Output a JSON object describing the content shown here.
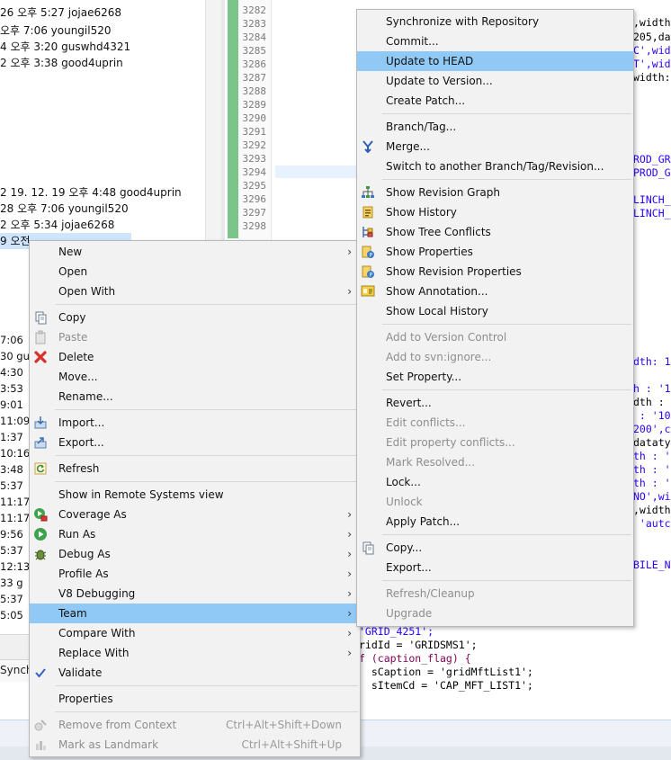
{
  "history": {
    "rows_top": [
      "26 오후 5:27  jojae6268",
      "오후 7:06  youngil520",
      "4 오후 3:20  guswhd4321",
      " 2 오후 3:38  good4uprin"
    ],
    "rows_mid": [
      "2  19. 12. 19 오후 4:48  good4uprin",
      "28 오후 7:06  youngil520",
      "2 오후 5:34  jojae6268",
      "9 오전"
    ],
    "fragments": [
      "7:06",
      "30  gu",
      "4:30",
      "3:53",
      "9:01",
      "11:09",
      "1:37",
      "10:16",
      "3:48",
      "5:37",
      "11:17",
      "11:17",
      "9:56",
      "5:37",
      "12:13",
      "33  g",
      "5:37",
      "5:05"
    ],
    "synchro_tab": "Synch"
  },
  "editor": {
    "line_numbers": [
      "3282",
      "3283",
      "3284",
      "3285",
      "3286",
      "3287",
      "3288",
      "3289",
      "3290",
      "3291",
      "3292",
      "3293",
      "3294",
      "3295",
      "3296",
      "3297",
      "3298"
    ],
    "right_fragments": [
      {
        "text": ",width",
        "color": "black"
      },
      {
        "text": "205,dat",
        "color": "black"
      },
      {
        "text": "C',wid",
        "color": "black"
      },
      {
        "text": "T',wid",
        "color": "black"
      },
      {
        "text": "width:1",
        "color": "black"
      },
      {
        "text": "ROD_GRI",
        "color": "blue"
      },
      {
        "text": "PROD_GR",
        "color": "blue"
      },
      {
        "text": "LINCH_",
        "color": "blue"
      },
      {
        "text": "LINCH_",
        "color": "blue"
      },
      {
        "text": "dth: 1",
        "color": "blue"
      },
      {
        "text": "h : '1",
        "color": "blue"
      },
      {
        "text": "dth : '",
        "color": "black"
      },
      {
        "text": " : '10",
        "color": "blue"
      },
      {
        "text": "200',c",
        "color": "blue"
      },
      {
        "text": "datatyp",
        "color": "black"
      },
      {
        "text": "th : 'a",
        "color": "blue"
      },
      {
        "text": "th : 'a",
        "color": "blue"
      },
      {
        "text": "th : 'a",
        "color": "blue"
      },
      {
        "text": "NO',wid",
        "color": "blue"
      },
      {
        "text": ",width",
        "color": "black"
      },
      {
        "text": " 'autc",
        "color": "blue"
      },
      {
        "text": "BILE_NO",
        "color": "blue"
      }
    ],
    "bottom_code": [
      "'GRID_4251';",
      "ridId = 'GRIDSMS1';",
      "f (caption_flag) {",
      "  sCaption = 'gridMftList1';",
      "  sItemCd = 'CAP_MFT_LIST1';"
    ]
  },
  "context_menu": {
    "items": [
      {
        "label": "New",
        "submenu": true
      },
      {
        "label": "Open"
      },
      {
        "label": "Open With",
        "submenu": true
      },
      {
        "label": "Copy",
        "icon": "copy-icon"
      },
      {
        "label": "Paste",
        "icon": "paste-icon",
        "disabled": true
      },
      {
        "label": "Delete",
        "icon": "delete-icon"
      },
      {
        "label": "Move..."
      },
      {
        "label": "Rename..."
      },
      {
        "label": "Import...",
        "icon": "import-icon"
      },
      {
        "label": "Export...",
        "icon": "export-icon"
      },
      {
        "label": "Refresh",
        "icon": "refresh-icon"
      },
      {
        "label": "Show in Remote Systems view"
      },
      {
        "label": "Coverage As",
        "icon": "coverage-icon",
        "submenu": true
      },
      {
        "label": "Run As",
        "icon": "run-icon",
        "submenu": true
      },
      {
        "label": "Debug As",
        "icon": "debug-icon",
        "submenu": true
      },
      {
        "label": "Profile As",
        "submenu": true
      },
      {
        "label": "V8 Debugging",
        "submenu": true
      },
      {
        "label": "Team",
        "submenu": true,
        "highlighted": true
      },
      {
        "label": "Compare With",
        "submenu": true
      },
      {
        "label": "Replace With",
        "submenu": true
      },
      {
        "label": "Validate",
        "icon": "check-icon"
      },
      {
        "label": "Properties"
      },
      {
        "label": "Remove from Context",
        "shortcut": "Ctrl+Alt+Shift+Down",
        "disabled": true
      },
      {
        "label": "Mark as Landmark",
        "shortcut": "Ctrl+Alt+Shift+Up",
        "disabled": true
      }
    ]
  },
  "team_menu": {
    "items": [
      {
        "label": "Synchronize with Repository"
      },
      {
        "label": "Commit..."
      },
      {
        "label": "Update to HEAD",
        "highlighted": true
      },
      {
        "label": "Update to Version..."
      },
      {
        "label": "Create Patch..."
      },
      {
        "label": "Branch/Tag..."
      },
      {
        "label": "Merge...",
        "icon": "merge-icon"
      },
      {
        "label": "Switch to another Branch/Tag/Revision..."
      },
      {
        "label": "Show Revision Graph",
        "icon": "revision-graph-icon"
      },
      {
        "label": "Show History",
        "icon": "history-icon"
      },
      {
        "label": "Show Tree Conflicts",
        "icon": "tree-conflicts-icon"
      },
      {
        "label": "Show Properties",
        "icon": "properties-icon"
      },
      {
        "label": "Show Revision Properties",
        "icon": "revision-properties-icon"
      },
      {
        "label": "Show Annotation...",
        "icon": "annotation-icon"
      },
      {
        "label": "Show Local History"
      },
      {
        "label": "Add to Version Control",
        "disabled": true
      },
      {
        "label": "Add to svn:ignore...",
        "disabled": true
      },
      {
        "label": "Set Property..."
      },
      {
        "label": "Revert..."
      },
      {
        "label": "Edit conflicts...",
        "disabled": true
      },
      {
        "label": "Edit property conflicts...",
        "disabled": true
      },
      {
        "label": "Mark Resolved...",
        "disabled": true
      },
      {
        "label": "Lock..."
      },
      {
        "label": "Unlock",
        "disabled": true
      },
      {
        "label": "Apply Patch..."
      },
      {
        "label": "Copy...",
        "icon": "copy-icon"
      },
      {
        "label": "Export..."
      },
      {
        "label": "Refresh/Cleanup",
        "disabled": true
      },
      {
        "label": "Upgrade",
        "disabled": true
      }
    ]
  },
  "colors": {
    "menu_bg": "#f2f2f2",
    "highlight": "#90c8f6",
    "disabled_text": "#8e8e8e",
    "svn_green": "#7bc48a"
  }
}
